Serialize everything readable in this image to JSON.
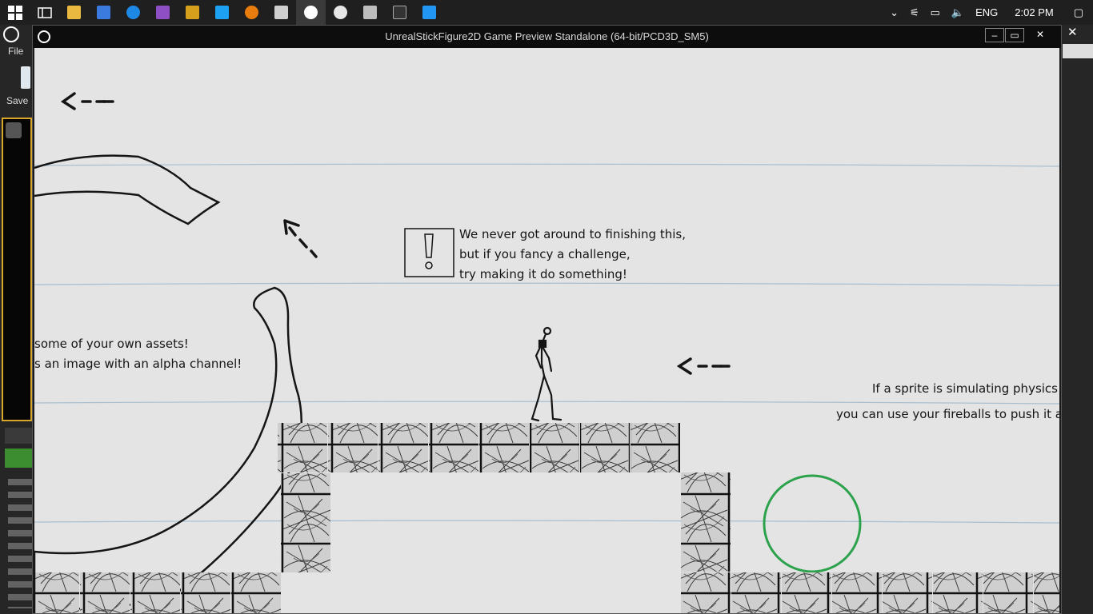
{
  "taskbar": {
    "icons": [
      "windows-start-icon",
      "task-view-icon",
      "file-explorer-icon",
      "store-icon",
      "edge-icon",
      "visual-studio-icon",
      "app-icon",
      "photos-icon",
      "blender-icon",
      "unity-icon",
      "unreal-editor-icon",
      "unreal-editor-2-icon",
      "document-icon",
      "epic-games-icon",
      "sketch-icon"
    ],
    "tray": {
      "language": "ENG",
      "time": "2:02 PM"
    }
  },
  "editor": {
    "menu_file": "File",
    "save_label": "Save"
  },
  "window": {
    "title": "UnrealStickFigure2D Game Preview Standalone (64-bit/PCD3D_SM5)",
    "minimize": "–",
    "maximize": "▭",
    "close": "✕"
  },
  "scene": {
    "notice_lines": [
      "We never got around to finishing this,",
      "but if you fancy a challenge,",
      "try making it do something!"
    ],
    "assets_lines": [
      "some of your own assets!",
      "s an image with an alpha channel!"
    ],
    "physics_lines": [
      "If a sprite is simulating physics",
      "you can use your fireballs to push it a"
    ],
    "colors": {
      "paper": "#e4e4e4",
      "ink": "#151515",
      "circle": "#2ca24c",
      "guide_lines": "#a9bfd0"
    }
  }
}
